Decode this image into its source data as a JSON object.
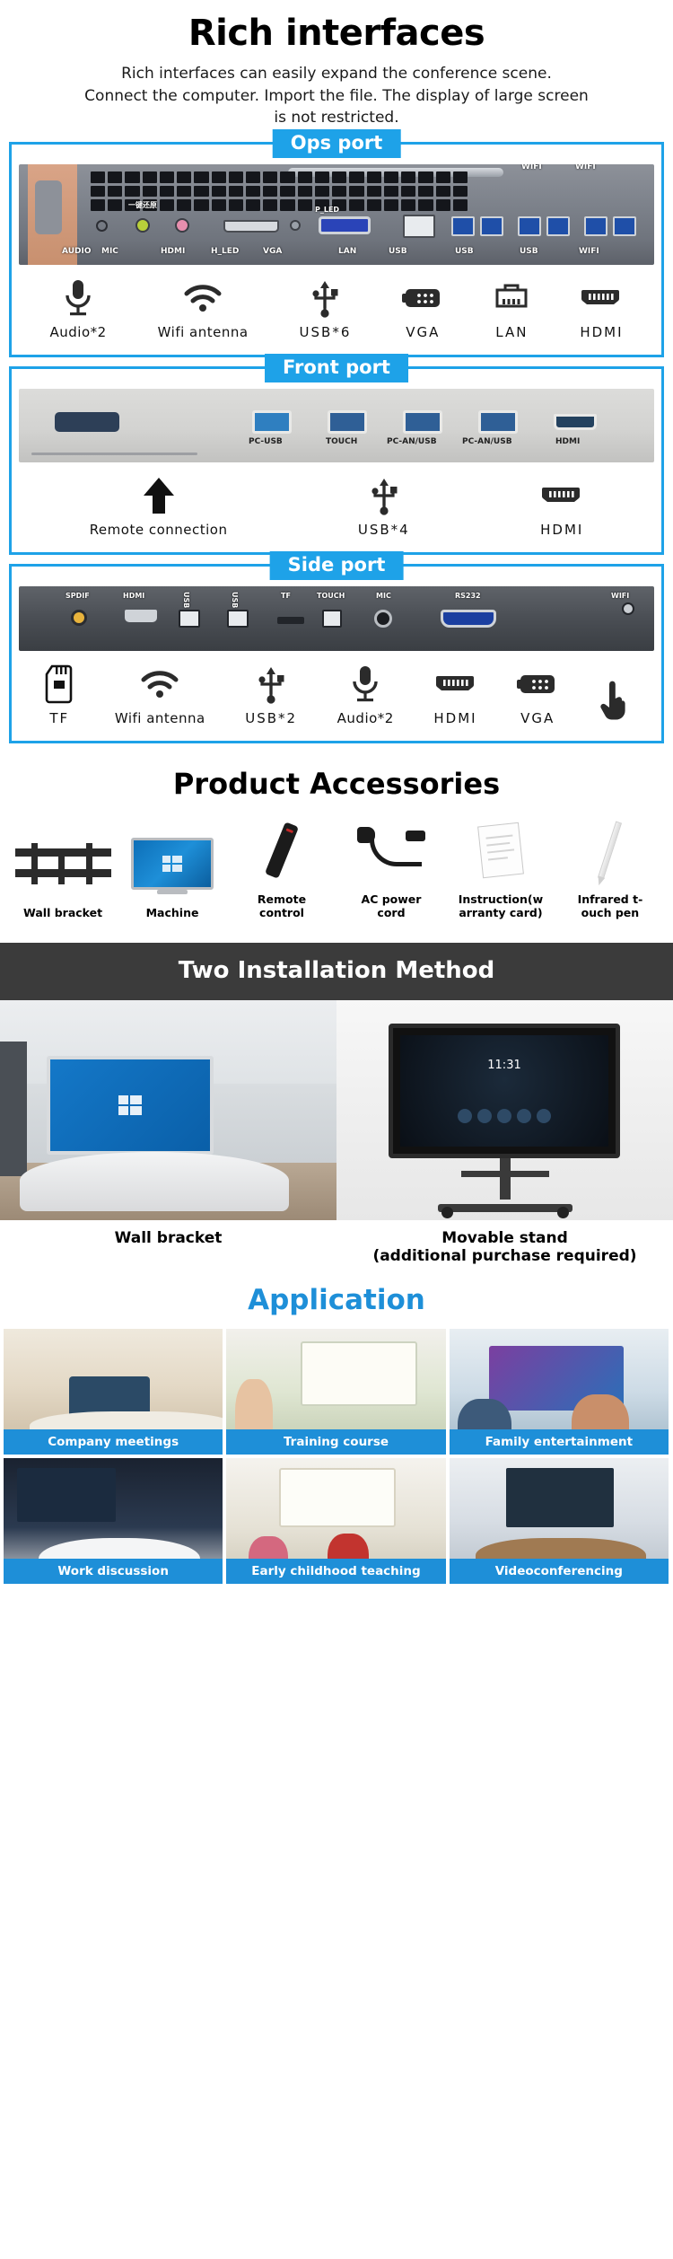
{
  "header": {
    "title": "Rich interfaces",
    "subtitle_line1": "Rich interfaces can easily expand the conference scene.",
    "subtitle_line2": "Connect the computer. Import the file. The display of large screen",
    "subtitle_line3": "is not restricted."
  },
  "accent_color": "#1e8fd8",
  "ports": {
    "ops": {
      "tag": "Ops port",
      "board_labels": [
        "一键还原",
        "P_LED",
        "AUDIO",
        "MIC",
        "HDMI",
        "H_LED",
        "VGA",
        "LAN",
        "USB",
        "USB",
        "USB",
        "WIFI",
        "WIFI"
      ],
      "items": [
        {
          "icon": "microphone-icon",
          "label": "Audio*2"
        },
        {
          "icon": "wifi-icon",
          "label": "Wifi antenna"
        },
        {
          "icon": "usb-icon",
          "label": "USB*6"
        },
        {
          "icon": "vga-icon",
          "label": "VGA"
        },
        {
          "icon": "lan-icon",
          "label": "LAN"
        },
        {
          "icon": "hdmi-icon",
          "label": "HDMI"
        }
      ]
    },
    "front": {
      "tag": "Front port",
      "board_labels": [
        "PC-USB",
        "TOUCH",
        "PC-AN/USB",
        "PC-AN/USB",
        "HDMI"
      ],
      "items": [
        {
          "icon": "up-arrow-icon",
          "label": "Remote connection"
        },
        {
          "icon": "usb-icon",
          "label": "USB*4"
        },
        {
          "icon": "hdmi-icon",
          "label": "HDMI"
        }
      ]
    },
    "side": {
      "tag": "Side port",
      "board_labels": [
        "SPDIF",
        "HDMI",
        "USB",
        "USB",
        "TF",
        "TOUCH",
        "MIC",
        "RS232",
        "WIFI"
      ],
      "items": [
        {
          "icon": "sd-card-icon",
          "label": "TF"
        },
        {
          "icon": "wifi-icon",
          "label": "Wifi antenna"
        },
        {
          "icon": "usb-icon",
          "label": "USB*2"
        },
        {
          "icon": "microphone-icon",
          "label": "Audio*2"
        },
        {
          "icon": "hdmi-icon",
          "label": "HDMI"
        },
        {
          "icon": "vga-icon",
          "label": "VGA"
        },
        {
          "icon": "touch-hand-icon",
          "label": ""
        }
      ]
    }
  },
  "accessories": {
    "title": "Product Accessories",
    "items": [
      {
        "icon": "wall-bracket-icon",
        "label": "Wall bracket"
      },
      {
        "icon": "machine-icon",
        "label": "Machine"
      },
      {
        "icon": "remote-control-icon",
        "label": "Remote\ncontrol"
      },
      {
        "icon": "power-cord-icon",
        "label": "AC power\ncord"
      },
      {
        "icon": "manual-icon",
        "label": "Instruction(w\narranty card)"
      },
      {
        "icon": "stylus-pen-icon",
        "label": "Infrared t-\nouch pen"
      }
    ]
  },
  "installation": {
    "title": "Two Installation Method",
    "left_caption": "Wall bracket",
    "right_caption_line1": "Movable stand",
    "right_caption_line2": "(additional purchase required)",
    "stand_screen_clock": "11:31"
  },
  "application": {
    "title": "Application",
    "cards": [
      {
        "caption": "Company meetings"
      },
      {
        "caption": "Training course"
      },
      {
        "caption": "Family entertainment"
      },
      {
        "caption": "Work discussion"
      },
      {
        "caption": "Early childhood teaching"
      },
      {
        "caption": "Videoconferencing"
      }
    ]
  }
}
